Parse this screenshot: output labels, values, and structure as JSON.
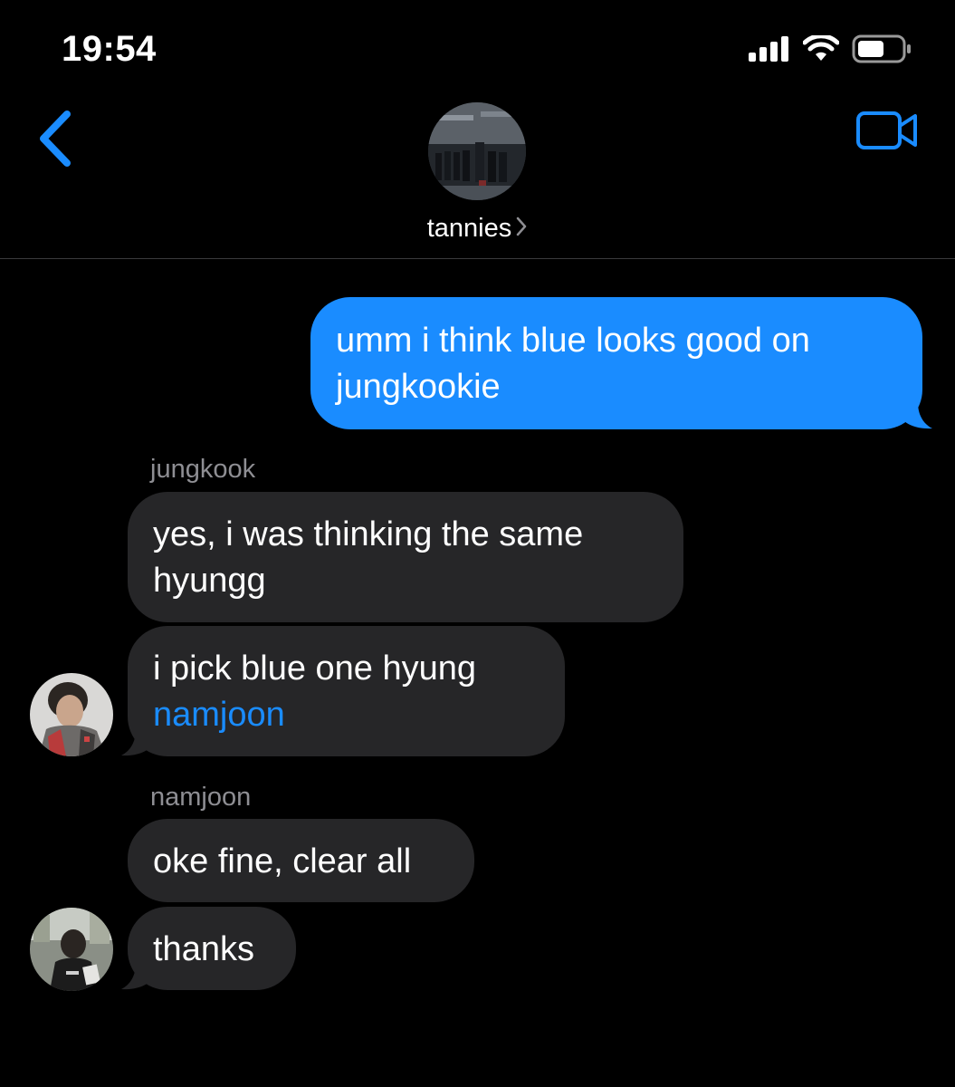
{
  "status_bar": {
    "time": "19:54",
    "icons": [
      "signal-icon",
      "wifi-icon",
      "battery-icon"
    ]
  },
  "header": {
    "group_name": "tannies",
    "back_icon": "chevron-left-icon",
    "video_icon": "video-camera-icon",
    "accent_color": "#1a8cff"
  },
  "messages": [
    {
      "direction": "outgoing",
      "lines": [
        "umm i think blue looks good on",
        "jungkookie"
      ]
    },
    {
      "direction": "incoming",
      "sender": "jungkook",
      "lines": [
        "yes, i was thinking the same",
        "hyungg"
      ]
    },
    {
      "direction": "incoming",
      "lines": [
        "i pick blue one hyung"
      ],
      "mention": "namjoon"
    },
    {
      "direction": "incoming",
      "sender": "namjoon",
      "lines": [
        "oke fine, clear all"
      ]
    },
    {
      "direction": "incoming",
      "lines": [
        "thanks"
      ]
    }
  ],
  "colors": {
    "background": "#000000",
    "outgoing_bubble": "#1a8cff",
    "incoming_bubble": "#262628",
    "sender_label": "#8e8e93"
  }
}
